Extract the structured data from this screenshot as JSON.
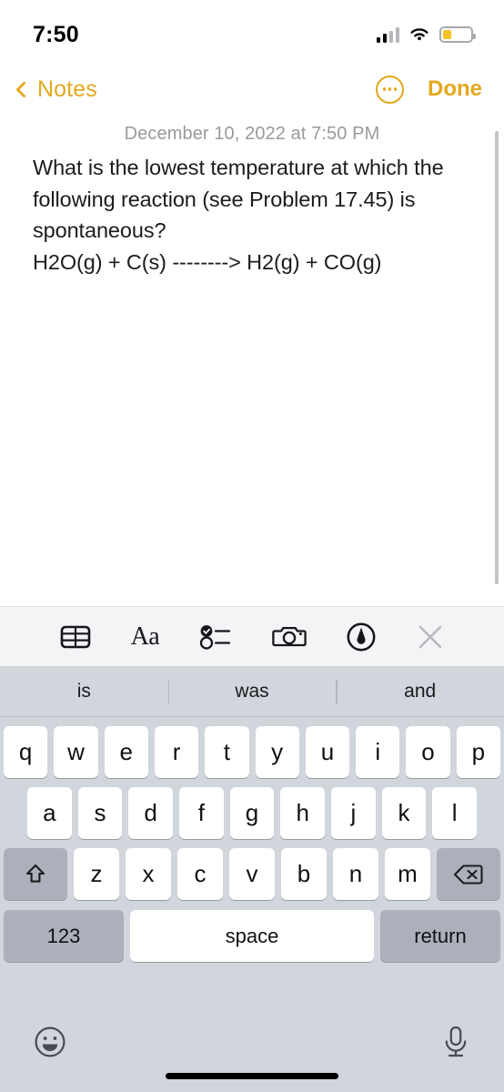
{
  "status_bar": {
    "time": "7:50",
    "signal_bars_filled": 2,
    "signal_bars_total": 4,
    "wifi_icon": "wifi-icon",
    "battery_icon": "battery-low-icon",
    "battery_color": "#f5c324",
    "battery_level_percent": 30
  },
  "nav_bar": {
    "back_label": "Notes",
    "back_icon": "chevron-left-icon",
    "more_icon": "ellipsis-circle-icon",
    "done_label": "Done",
    "accent_color": "#E3A81E"
  },
  "note": {
    "date": "December 10, 2022 at 7:50 PM",
    "body": "What is the lowest temperature at which the following reaction (see Problem 17.45) is spontaneous?\nH2O(g) + C(s) --------> H2(g) + CO(g)"
  },
  "format_toolbar": {
    "items": [
      {
        "name": "table-icon",
        "label": ""
      },
      {
        "name": "format-text-icon",
        "label": "Aa"
      },
      {
        "name": "checklist-icon",
        "label": ""
      },
      {
        "name": "camera-icon",
        "label": ""
      },
      {
        "name": "markup-pen-icon",
        "label": ""
      },
      {
        "name": "close-icon",
        "label": ""
      }
    ]
  },
  "keyboard": {
    "predictions": [
      "is",
      "was",
      "and"
    ],
    "row1": [
      "q",
      "w",
      "e",
      "r",
      "t",
      "y",
      "u",
      "i",
      "o",
      "p"
    ],
    "row2": [
      "a",
      "s",
      "d",
      "f",
      "g",
      "h",
      "j",
      "k",
      "l"
    ],
    "row3": [
      "z",
      "x",
      "c",
      "v",
      "b",
      "n",
      "m"
    ],
    "shift_icon": "shift-arrow-icon",
    "delete_icon": "backspace-icon",
    "numbers_label": "123",
    "space_label": "space",
    "return_label": "return",
    "emoji_icon": "emoji-smiley-icon",
    "dictation_icon": "microphone-icon"
  }
}
